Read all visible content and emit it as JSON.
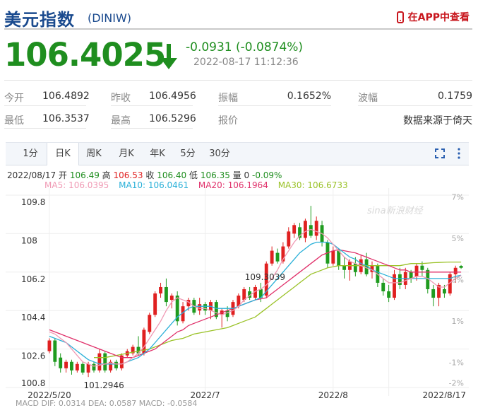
{
  "header": {
    "name": "美元指数",
    "code": "(DINIW)",
    "app_link": "在APP中查看",
    "price": "106.4025",
    "change": "-0.0931 (-0.0874%)",
    "time": "2022-08-17  11:12:36"
  },
  "stats": {
    "row1": [
      {
        "label": "今开",
        "value": "106.4892"
      },
      {
        "label": "昨收",
        "value": "106.4956"
      },
      {
        "label": "振幅",
        "value": "0.1652%"
      },
      {
        "label": "波幅",
        "value": "0.1759"
      }
    ],
    "row2": [
      {
        "label": "最低",
        "value": "106.3537"
      },
      {
        "label": "最高",
        "value": "106.5296"
      },
      {
        "label": "报价",
        "value": "数据来源于倚天"
      }
    ]
  },
  "tabs": [
    "1分",
    "日K",
    "周K",
    "月K",
    "年K",
    "5分",
    "30分"
  ],
  "active_tab": "日K",
  "ohlc": {
    "date": "2022/08/17",
    "open_label": "开",
    "open": "106.49",
    "high_label": "高",
    "high": "106.53",
    "close_label": "收",
    "close": "106.40",
    "low_label": "低",
    "low": "106.35",
    "vol_label": "量",
    "vol": "0",
    "pct": "-0.09%"
  },
  "ma_legend": [
    {
      "text": "MA5: 106.0395",
      "color": "#f09ab4"
    },
    {
      "text": "MA10: 106.0461",
      "color": "#2ab0d8"
    },
    {
      "text": "MA20: 106.1964",
      "color": "#e0306a"
    },
    {
      "text": "MA30: 106.6733",
      "color": "#9ac227"
    }
  ],
  "watermark": "sina新浪财经",
  "macd_text": "MACD  DIF: 0.0314    DEA: 0.0587    MACD: -0.0584",
  "chart_data": {
    "type": "candlestick",
    "y_ticks": [
      "109.8",
      "108",
      "106.2",
      "104.4",
      "102.6",
      "100.8"
    ],
    "y_tick_values": [
      109.8,
      108,
      106.2,
      104.4,
      102.6,
      100.8
    ],
    "ylim": [
      100.8,
      109.8
    ],
    "pct_ticks": [
      "7%",
      "5%",
      "3%",
      "1%",
      "-1%",
      "-2%"
    ],
    "pct_tick_values": [
      7,
      5,
      3,
      1,
      -1,
      -2
    ],
    "pct_lim": [
      -2.22,
      7.08
    ],
    "x_labels": [
      "2022/5/20",
      "2022/7",
      "2022/8",
      "2022/8/17"
    ],
    "x_label_index": [
      0,
      28,
      51,
      61
    ],
    "max_label": "109.3039",
    "max_index": 38,
    "min_label": "101.2946",
    "min_index": 7,
    "up_color": "#e02020",
    "down_color": "#1f9b1f",
    "candles": [
      {
        "o": 102.5,
        "c": 103.0,
        "h": 103.1,
        "l": 102.4
      },
      {
        "o": 103.0,
        "c": 102.0,
        "h": 103.1,
        "l": 101.8
      },
      {
        "o": 102.2,
        "c": 101.7,
        "h": 102.4,
        "l": 101.5
      },
      {
        "o": 101.7,
        "c": 102.0,
        "h": 102.1,
        "l": 101.5
      },
      {
        "o": 102.0,
        "c": 101.6,
        "h": 102.1,
        "l": 101.4
      },
      {
        "o": 101.6,
        "c": 101.9,
        "h": 102.0,
        "l": 101.5
      },
      {
        "o": 101.9,
        "c": 101.5,
        "h": 102.0,
        "l": 101.4
      },
      {
        "o": 101.5,
        "c": 101.9,
        "h": 102.0,
        "l": 101.29
      },
      {
        "o": 101.9,
        "c": 101.6,
        "h": 102.0,
        "l": 101.5
      },
      {
        "o": 101.6,
        "c": 102.4,
        "h": 102.6,
        "l": 101.5
      },
      {
        "o": 102.4,
        "c": 101.6,
        "h": 102.5,
        "l": 101.5
      },
      {
        "o": 101.6,
        "c": 102.0,
        "h": 102.1,
        "l": 101.5
      },
      {
        "o": 102.0,
        "c": 101.7,
        "h": 102.1,
        "l": 101.6
      },
      {
        "o": 101.7,
        "c": 102.3,
        "h": 102.4,
        "l": 101.6
      },
      {
        "o": 102.3,
        "c": 102.5,
        "h": 102.6,
        "l": 102.2
      },
      {
        "o": 102.4,
        "c": 102.7,
        "h": 102.8,
        "l": 102.3
      },
      {
        "o": 102.7,
        "c": 102.4,
        "h": 103.2,
        "l": 102.3
      },
      {
        "o": 102.4,
        "c": 103.5,
        "h": 103.6,
        "l": 102.3
      },
      {
        "o": 103.4,
        "c": 104.2,
        "h": 104.3,
        "l": 103.3
      },
      {
        "o": 104.2,
        "c": 105.2,
        "h": 105.3,
        "l": 104.1
      },
      {
        "o": 105.2,
        "c": 105.5,
        "h": 105.7,
        "l": 105.0
      },
      {
        "o": 105.5,
        "c": 104.8,
        "h": 105.9,
        "l": 104.6
      },
      {
        "o": 104.9,
        "c": 105.1,
        "h": 105.2,
        "l": 104.5
      },
      {
        "o": 105.1,
        "c": 103.9,
        "h": 105.3,
        "l": 103.7
      },
      {
        "o": 103.9,
        "c": 104.6,
        "h": 104.8,
        "l": 103.8
      },
      {
        "o": 104.6,
        "c": 104.9,
        "h": 105.0,
        "l": 104.4
      },
      {
        "o": 104.9,
        "c": 104.3,
        "h": 105.0,
        "l": 104.2
      },
      {
        "o": 104.4,
        "c": 104.7,
        "h": 105.0,
        "l": 104.2
      },
      {
        "o": 104.7,
        "c": 104.4,
        "h": 104.8,
        "l": 104.2
      },
      {
        "o": 104.4,
        "c": 104.8,
        "h": 104.9,
        "l": 104.0
      },
      {
        "o": 104.8,
        "c": 104.1,
        "h": 104.9,
        "l": 104.0
      },
      {
        "o": 104.2,
        "c": 104.4,
        "h": 104.5,
        "l": 103.6
      },
      {
        "o": 104.4,
        "c": 104.1,
        "h": 104.6,
        "l": 103.9
      },
      {
        "o": 104.2,
        "c": 104.8,
        "h": 104.9,
        "l": 104.1
      },
      {
        "o": 104.6,
        "c": 105.1,
        "h": 105.2,
        "l": 104.5
      },
      {
        "o": 104.9,
        "c": 105.4,
        "h": 105.5,
        "l": 104.8
      },
      {
        "o": 105.3,
        "c": 105.0,
        "h": 105.5,
        "l": 104.9
      },
      {
        "o": 105.0,
        "c": 105.5,
        "h": 105.6,
        "l": 104.9
      },
      {
        "o": 105.4,
        "c": 105.0,
        "h": 105.7,
        "l": 104.8
      },
      {
        "o": 105.1,
        "c": 106.6,
        "h": 106.7,
        "l": 105.0
      },
      {
        "o": 106.6,
        "c": 107.2,
        "h": 107.4,
        "l": 106.5
      },
      {
        "o": 107.1,
        "c": 106.7,
        "h": 107.3,
        "l": 106.6
      },
      {
        "o": 106.7,
        "c": 107.4,
        "h": 107.6,
        "l": 106.6
      },
      {
        "o": 107.4,
        "c": 108.1,
        "h": 108.3,
        "l": 107.3
      },
      {
        "o": 108.0,
        "c": 108.4,
        "h": 108.5,
        "l": 107.8
      },
      {
        "o": 108.3,
        "c": 107.8,
        "h": 108.5,
        "l": 107.7
      },
      {
        "o": 107.8,
        "c": 108.6,
        "h": 108.7,
        "l": 107.6
      },
      {
        "o": 108.4,
        "c": 107.9,
        "h": 109.3,
        "l": 107.8
      },
      {
        "o": 107.9,
        "c": 108.6,
        "h": 108.8,
        "l": 107.7
      },
      {
        "o": 108.4,
        "c": 107.6,
        "h": 108.6,
        "l": 107.4
      },
      {
        "o": 107.6,
        "c": 106.6,
        "h": 107.7,
        "l": 106.4
      },
      {
        "o": 106.6,
        "c": 107.2,
        "h": 107.4,
        "l": 106.5
      },
      {
        "o": 107.2,
        "c": 106.5,
        "h": 107.3,
        "l": 106.3
      },
      {
        "o": 106.5,
        "c": 106.3,
        "h": 106.9,
        "l": 105.9
      },
      {
        "o": 106.3,
        "c": 106.7,
        "h": 106.8,
        "l": 105.8
      },
      {
        "o": 106.6,
        "c": 106.2,
        "h": 106.9,
        "l": 106.0
      },
      {
        "o": 106.2,
        "c": 106.8,
        "h": 107.0,
        "l": 106.1
      },
      {
        "o": 106.8,
        "c": 106.1,
        "h": 107.1,
        "l": 106.0
      },
      {
        "o": 106.2,
        "c": 106.5,
        "h": 106.7,
        "l": 105.9
      },
      {
        "o": 106.5,
        "c": 105.7,
        "h": 106.6,
        "l": 105.5
      },
      {
        "o": 105.7,
        "c": 105.3,
        "h": 105.9,
        "l": 105.1
      },
      {
        "o": 105.3,
        "c": 105.0,
        "h": 105.6,
        "l": 104.8
      },
      {
        "o": 105.0,
        "c": 106.1,
        "h": 106.3,
        "l": 104.9
      },
      {
        "o": 106.1,
        "c": 105.6,
        "h": 106.4,
        "l": 105.4
      },
      {
        "o": 105.6,
        "c": 106.2,
        "h": 106.4,
        "l": 105.4
      },
      {
        "o": 106.2,
        "c": 105.9,
        "h": 106.3,
        "l": 105.7
      },
      {
        "o": 106.0,
        "c": 106.5,
        "h": 106.6,
        "l": 105.8
      },
      {
        "o": 106.5,
        "c": 106.3,
        "h": 106.7,
        "l": 106.0
      },
      {
        "o": 106.3,
        "c": 105.4,
        "h": 106.4,
        "l": 105.2
      },
      {
        "o": 105.4,
        "c": 105.0,
        "h": 105.6,
        "l": 104.6
      },
      {
        "o": 105.0,
        "c": 105.6,
        "h": 105.7,
        "l": 104.6
      },
      {
        "o": 105.4,
        "c": 105.2,
        "h": 105.6,
        "l": 105.0
      },
      {
        "o": 105.2,
        "c": 106.1,
        "h": 106.2,
        "l": 105.1
      },
      {
        "o": 106.1,
        "c": 106.4,
        "h": 106.5,
        "l": 105.7
      },
      {
        "o": 106.49,
        "c": 106.4,
        "h": 106.53,
        "l": 106.35
      }
    ],
    "ma5": [
      103.4,
      103.3,
      103.1,
      102.9,
      102.6,
      102.3,
      102.0,
      101.9,
      101.8,
      101.85,
      101.9,
      101.95,
      101.9,
      101.9,
      102.0,
      102.2,
      102.4,
      102.7,
      103.1,
      103.5,
      103.9,
      104.4,
      104.8,
      105.0,
      104.9,
      104.8,
      104.6,
      104.5,
      104.5,
      104.4,
      104.3,
      104.2,
      104.3,
      104.4,
      104.6,
      104.9,
      105.1,
      105.3,
      105.4,
      105.6,
      105.9,
      106.3,
      106.8,
      107.2,
      107.6,
      107.9,
      108.1,
      108.2,
      108.1,
      108.0,
      107.8,
      107.5,
      107.2,
      106.9,
      106.7,
      106.6,
      106.5,
      106.4,
      106.3,
      106.1,
      105.9,
      105.7,
      105.7,
      105.7,
      105.8,
      105.9,
      106.0,
      106.0,
      105.9,
      105.7,
      105.5,
      105.5,
      105.7,
      105.9,
      106.04
    ],
    "ma10": [
      103.2,
      103.1,
      103.0,
      102.9,
      102.7,
      102.5,
      102.3,
      102.1,
      102.0,
      101.9,
      101.9,
      101.9,
      101.9,
      101.9,
      102.0,
      102.1,
      102.2,
      102.4,
      102.6,
      102.9,
      103.2,
      103.5,
      103.8,
      104.1,
      104.3,
      104.5,
      104.6,
      104.6,
      104.6,
      104.6,
      104.5,
      104.5,
      104.5,
      104.5,
      104.6,
      104.7,
      104.8,
      104.9,
      105.0,
      105.3,
      105.6,
      105.9,
      106.2,
      106.5,
      106.8,
      107.1,
      107.3,
      107.5,
      107.6,
      107.6,
      107.6,
      107.5,
      107.3,
      107.1,
      106.9,
      106.8,
      106.6,
      106.5,
      106.3,
      106.2,
      106.1,
      106.0,
      105.9,
      105.9,
      105.9,
      105.9,
      105.9,
      105.9,
      105.9,
      105.9,
      105.9,
      105.9,
      105.9,
      106.0,
      106.05
    ],
    "ma20": [
      103.5,
      103.4,
      103.3,
      103.2,
      103.1,
      103.0,
      102.9,
      102.8,
      102.7,
      102.6,
      102.5,
      102.4,
      102.3,
      102.2,
      102.2,
      102.2,
      102.3,
      102.4,
      102.5,
      102.6,
      102.8,
      103.0,
      103.2,
      103.4,
      103.5,
      103.7,
      103.8,
      103.9,
      104.0,
      104.1,
      104.2,
      104.3,
      104.4,
      104.5,
      104.6,
      104.7,
      104.8,
      104.9,
      104.95,
      105.0,
      105.2,
      105.4,
      105.6,
      105.8,
      106.0,
      106.2,
      106.4,
      106.6,
      106.8,
      107.0,
      107.1,
      107.2,
      107.25,
      107.2,
      107.15,
      107.1,
      107.0,
      106.9,
      106.8,
      106.7,
      106.6,
      106.5,
      106.4,
      106.3,
      106.3,
      106.2,
      106.2,
      106.2,
      106.2,
      106.2,
      106.2,
      106.2,
      106.2,
      106.2,
      106.2
    ],
    "ma30": [
      null,
      null,
      null,
      null,
      null,
      null,
      null,
      null,
      102.2,
      102.2,
      102.2,
      102.25,
      102.3,
      102.35,
      102.4,
      102.45,
      102.5,
      102.55,
      102.6,
      102.7,
      102.8,
      102.9,
      103.0,
      103.05,
      103.1,
      103.2,
      103.3,
      103.35,
      103.4,
      103.45,
      103.5,
      103.55,
      103.6,
      103.7,
      103.8,
      103.9,
      104.0,
      104.1,
      104.3,
      104.5,
      104.7,
      104.9,
      105.1,
      105.3,
      105.5,
      105.7,
      105.9,
      106.1,
      106.2,
      106.3,
      106.4,
      106.45,
      106.5,
      106.5,
      106.5,
      106.5,
      106.5,
      106.5,
      106.5,
      106.5,
      106.5,
      106.5,
      106.5,
      106.5,
      106.55,
      106.6,
      106.6,
      106.6,
      106.62,
      106.64,
      106.65,
      106.66,
      106.67,
      106.67,
      106.67
    ]
  }
}
